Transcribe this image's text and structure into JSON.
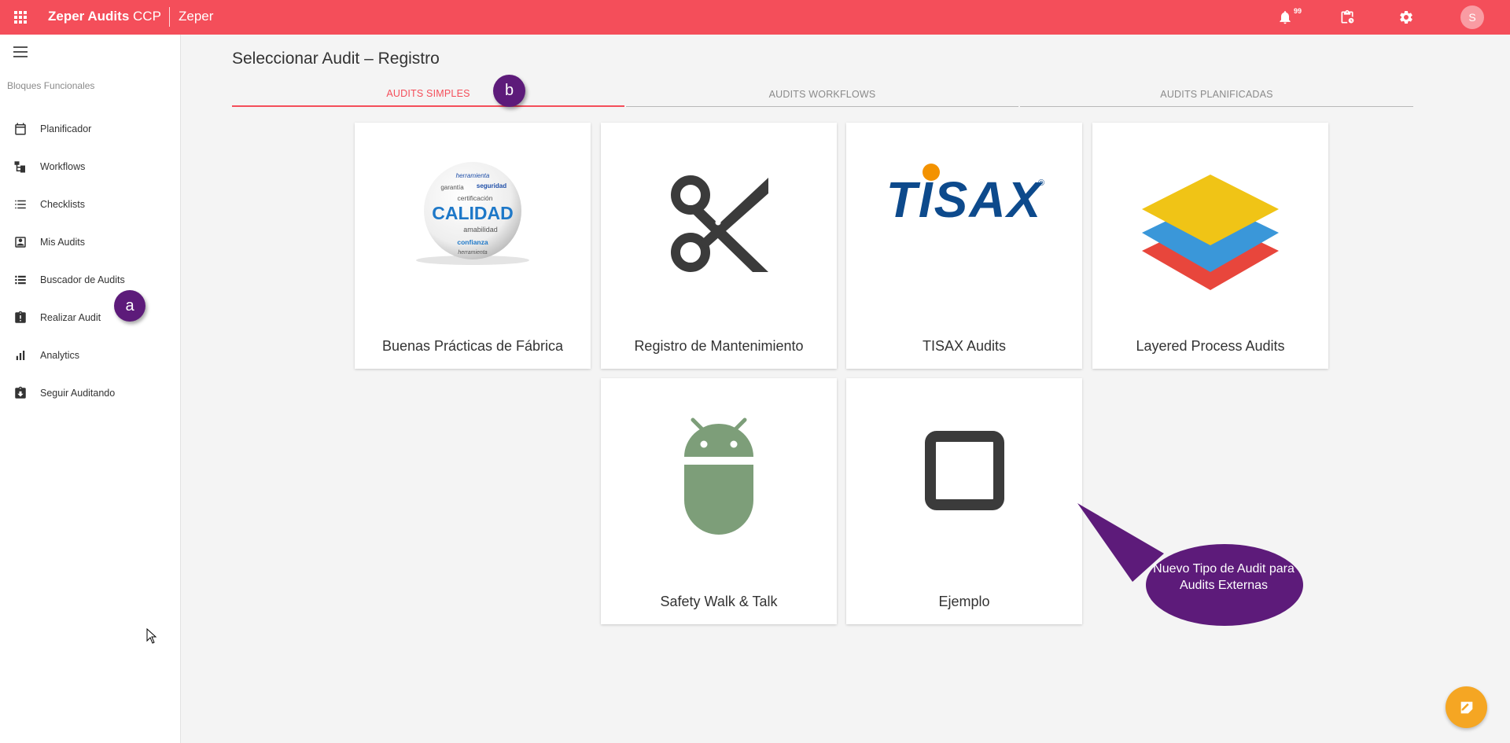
{
  "header": {
    "app_name": "Zeper Audits",
    "app_suffix": "CCP",
    "org_name": "Zeper",
    "notification_count": "99",
    "avatar_initial": "S"
  },
  "sidebar": {
    "section_title": "Bloques Funcionales",
    "items": [
      {
        "label": "Planificador",
        "icon": "calendar-icon"
      },
      {
        "label": "Workflows",
        "icon": "workflow-icon"
      },
      {
        "label": "Checklists",
        "icon": "list-icon"
      },
      {
        "label": "Mis Audits",
        "icon": "account-box-icon"
      },
      {
        "label": "Buscador de Audits",
        "icon": "list-search-icon"
      },
      {
        "label": "Realizar Audit",
        "icon": "clipboard-alert-icon"
      },
      {
        "label": "Analytics",
        "icon": "bar-chart-icon"
      },
      {
        "label": "Seguir Auditando",
        "icon": "clipboard-arrow-icon"
      }
    ]
  },
  "main": {
    "title": "Seleccionar Audit – Registro",
    "tabs": [
      {
        "label": "AUDITS SIMPLES",
        "active": true
      },
      {
        "label": "AUDITS WORKFLOWS",
        "active": false
      },
      {
        "label": "AUDITS PLANIFICADAS",
        "active": false
      }
    ],
    "cards": [
      {
        "label": "Buenas Prácticas de Fábrica",
        "icon": "calidad-globe-image",
        "globe_words": [
          "herramienta",
          "garantía",
          "seguridad",
          "certificación",
          "CALIDAD",
          "amabilidad",
          "confianza",
          "herramienta"
        ]
      },
      {
        "label": "Registro de Mantenimiento",
        "icon": "scissors-icon"
      },
      {
        "label": "TISAX Audits",
        "icon": "tisax-logo",
        "logo_text": "TISAX",
        "logo_mark": "®"
      },
      {
        "label": "Layered Process Audits",
        "icon": "layers-icon"
      },
      {
        "label": "Safety Walk & Talk",
        "icon": "android-icon"
      },
      {
        "label": "Ejemplo",
        "icon": "square-outline-icon"
      }
    ]
  },
  "annotations": {
    "bubble_a": "a",
    "bubble_b": "b",
    "callout": "Nuevo Tipo de Audit para Audits Externas"
  },
  "colors": {
    "brand_red": "#f44e5a",
    "annotation_purple": "#5d1b7a",
    "fab_orange": "#f5a623",
    "android_green": "#7d9e79"
  }
}
